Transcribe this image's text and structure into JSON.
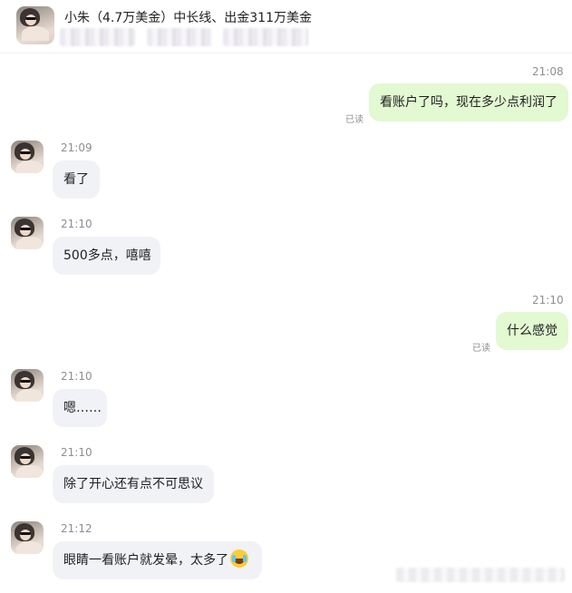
{
  "header": {
    "contact_name": "小朱（4.7万美金）中长线、出金311万美金"
  },
  "messages": [
    {
      "direction": "out",
      "time": "21:08",
      "text": "看账户了吗，现在多少点利润了",
      "read": "已读"
    },
    {
      "direction": "in",
      "time": "21:09",
      "text": "看了"
    },
    {
      "direction": "in",
      "time": "21:10",
      "text": "500多点，嘻嘻"
    },
    {
      "direction": "out",
      "time": "21:10",
      "text": "什么感觉",
      "read": "已读"
    },
    {
      "direction": "in",
      "time": "21:10",
      "text": "嗯……"
    },
    {
      "direction": "in",
      "time": "21:10",
      "text": "除了开心还有点不可思议"
    },
    {
      "direction": "in",
      "time": "21:12",
      "text": "眼睛一看账户就发晕，太多了",
      "emoji": "laughing-crying-emoji"
    }
  ],
  "colors": {
    "incoming_bubble": "#f1f2f6",
    "outgoing_bubble": "#e2f9d2"
  }
}
